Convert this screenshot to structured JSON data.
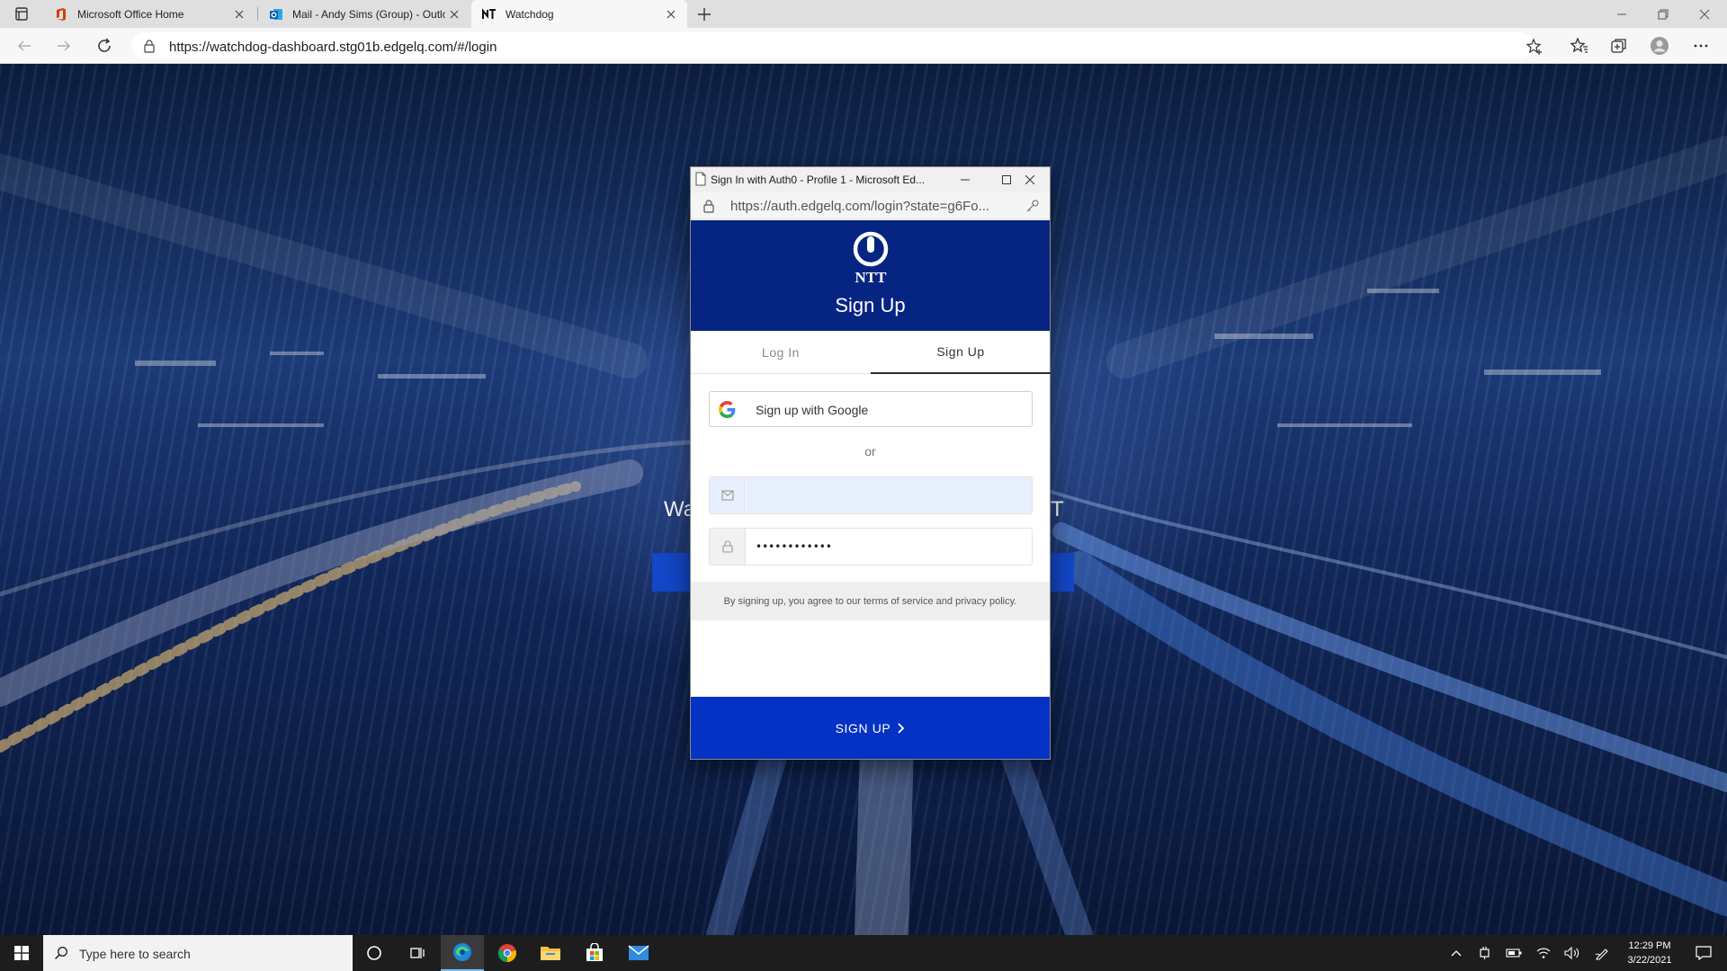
{
  "browser": {
    "tabs": [
      {
        "title": "Microsoft Office Home",
        "icon": "office-icon"
      },
      {
        "title": "Mail - Andy Sims (Group) - Outlo",
        "icon": "outlook-icon"
      },
      {
        "title": "Watchdog",
        "icon": "ntt-icon"
      }
    ],
    "url": "https://watchdog-dashboard.stg01b.edgelq.com/#/login"
  },
  "page": {
    "welcome_left": "Wa",
    "welcome_right": "T"
  },
  "popup": {
    "window_title": "Sign In with Auth0 - Profile 1 - Microsoft Ed...",
    "url": "https://auth.edgelq.com/login?state=g6Fo...",
    "brand": "NTT",
    "heading": "Sign Up",
    "tabs": {
      "login": "Log In",
      "signup": "Sign Up"
    },
    "google_label": "Sign up with Google",
    "or_label": "or",
    "email_value": "",
    "password_value": "••••••••••••",
    "terms": "By signing up, you agree to our terms of service and privacy policy.",
    "submit_label": "SIGN UP"
  },
  "taskbar": {
    "search_placeholder": "Type here to search",
    "time": "12:29 PM",
    "date": "3/22/2021"
  },
  "colors": {
    "auth_header": "#062482",
    "submit": "#0432c4",
    "taskbar": "#1d1d1d"
  }
}
